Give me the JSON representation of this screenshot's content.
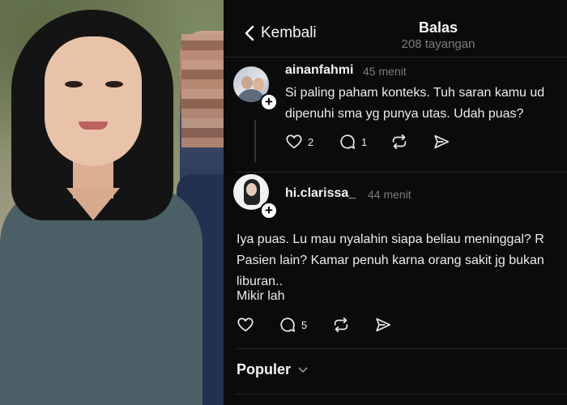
{
  "header": {
    "back_label": "Kembali",
    "title": "Balas",
    "views": "208 tayangan"
  },
  "posts": [
    {
      "username": "ainanfahmi",
      "time": "45 menit",
      "lines": [
        "Si paling paham konteks. Tuh saran kamu ud",
        "dipenuhi sma yg punya utas. Udah puas?"
      ],
      "likes": "2",
      "replies": "1"
    },
    {
      "username": "hi.clarissa_",
      "time": "44 menit",
      "lines": [
        "Iya puas. Lu mau nyalahin siapa beliau meninggal? R",
        "Pasien lain? Kamar penuh karna orang sakit jg bukan",
        "liburan..",
        "Mikir lah"
      ],
      "likes": "",
      "replies": "5"
    }
  ],
  "section": {
    "label": "Populer"
  },
  "icons": {
    "back": "chevron-left-icon",
    "like": "heart-icon",
    "reply": "comment-icon",
    "repost": "repost-icon",
    "share": "send-icon",
    "follow": "plus-icon",
    "dropdown": "chevron-down-icon"
  },
  "colors": {
    "background": "#0b0b0b",
    "text": "#f3f3f3",
    "muted": "#7b7b7b",
    "divider": "#262626"
  }
}
